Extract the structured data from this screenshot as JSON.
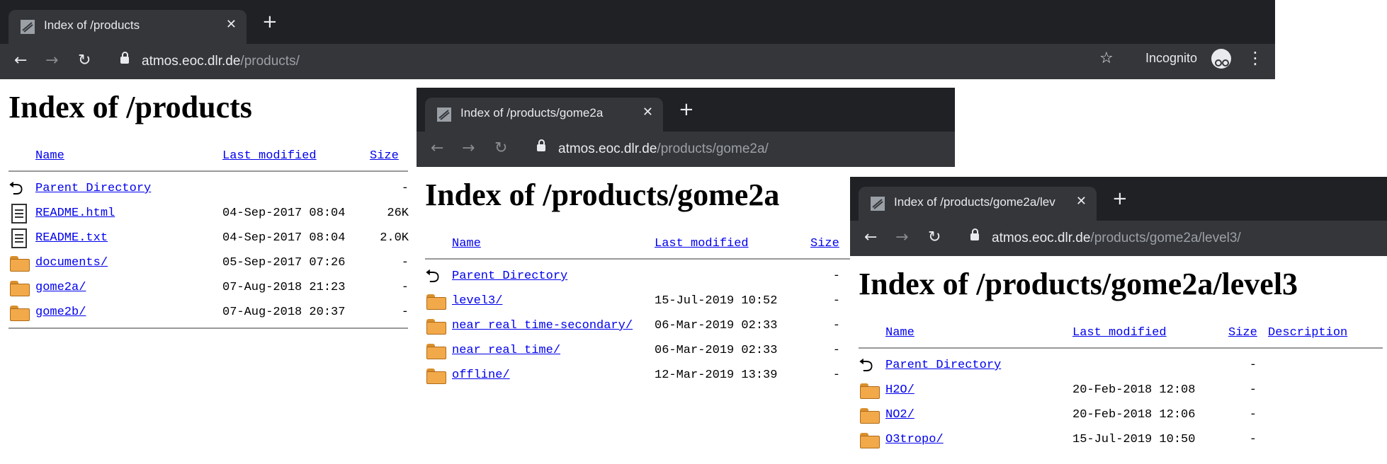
{
  "win1": {
    "tab_title": "Index of /products",
    "url_host": "atmos.eoc.dlr.de",
    "url_path": "/products/",
    "incognito_label": "Incognito",
    "heading": "Index of /products",
    "headers": {
      "name": "Name",
      "modified": "Last modified",
      "size": "Size"
    },
    "rows": [
      {
        "icon": "parent-icon",
        "name": "Parent Directory",
        "modified": "",
        "size": "-"
      },
      {
        "icon": "document-icon",
        "name": "README.html",
        "modified": "04-Sep-2017 08:04",
        "size": "26K"
      },
      {
        "icon": "document-icon",
        "name": "README.txt",
        "modified": "04-Sep-2017 08:04",
        "size": "2.0K"
      },
      {
        "icon": "folder-icon",
        "name": "documents/",
        "modified": "05-Sep-2017 07:26",
        "size": "-"
      },
      {
        "icon": "folder-icon",
        "name": "gome2a/",
        "modified": "07-Aug-2018 21:23",
        "size": "-"
      },
      {
        "icon": "folder-icon",
        "name": "gome2b/",
        "modified": "07-Aug-2018 20:37",
        "size": "-"
      }
    ]
  },
  "win2": {
    "tab_title": "Index of /products/gome2a",
    "url_host": "atmos.eoc.dlr.de",
    "url_path": "/products/gome2a/",
    "heading": "Index of /products/gome2a",
    "headers": {
      "name": "Name",
      "modified": "Last modified",
      "size": "Size"
    },
    "rows": [
      {
        "icon": "parent-icon",
        "name": "Parent Directory",
        "modified": "",
        "size": "-"
      },
      {
        "icon": "folder-icon",
        "name": "level3/",
        "modified": "15-Jul-2019 10:52",
        "size": "-"
      },
      {
        "icon": "folder-icon",
        "name": "near_real_time-secondary/",
        "modified": "06-Mar-2019 02:33",
        "size": "-"
      },
      {
        "icon": "folder-icon",
        "name": "near_real_time/",
        "modified": "06-Mar-2019 02:33",
        "size": "-"
      },
      {
        "icon": "folder-icon",
        "name": "offline/",
        "modified": "12-Mar-2019 13:39",
        "size": "-"
      }
    ]
  },
  "win3": {
    "tab_title": "Index of /products/gome2a/lev",
    "url_host": "atmos.eoc.dlr.de",
    "url_path": "/products/gome2a/level3/",
    "heading": "Index of /products/gome2a/level3",
    "headers": {
      "name": "Name",
      "modified": "Last modified",
      "size": "Size",
      "description": "Description"
    },
    "rows": [
      {
        "icon": "parent-icon",
        "name": "Parent Directory",
        "modified": "",
        "size": "-"
      },
      {
        "icon": "folder-icon",
        "name": "H2O/",
        "modified": "20-Feb-2018 12:08",
        "size": "-"
      },
      {
        "icon": "folder-icon",
        "name": "NO2/",
        "modified": "20-Feb-2018 12:06",
        "size": "-"
      },
      {
        "icon": "folder-icon",
        "name": "O3tropo/",
        "modified": "15-Jul-2019 10:50",
        "size": "-"
      }
    ]
  },
  "colors": {
    "tabstrip": "#202124",
    "toolbar": "#35363a",
    "link": "#0000ee"
  }
}
